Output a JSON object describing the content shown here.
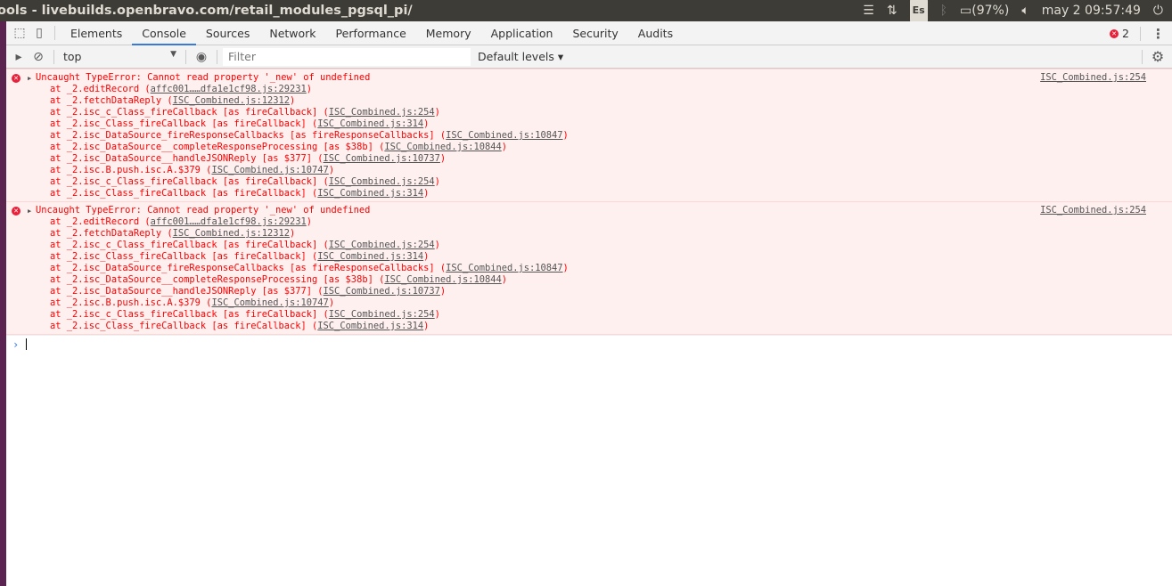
{
  "window": {
    "title": "ools - livebuilds.openbravo.com/retail_modules_pgsql_pi/"
  },
  "tray": {
    "keyboard": "Es",
    "battery": "(97%)",
    "clock": "may  2 09:57:49"
  },
  "tabs": [
    "Elements",
    "Console",
    "Sources",
    "Network",
    "Performance",
    "Memory",
    "Application",
    "Security",
    "Audits"
  ],
  "active_tab": "Console",
  "error_count": "2",
  "toolbar": {
    "context": "top",
    "filter_placeholder": "Filter",
    "levels": "Default levels ▾"
  },
  "messages": [
    {
      "text": "Uncaught TypeError: Cannot read property '_new' of undefined",
      "source": "ISC_Combined.js:254",
      "stack": [
        {
          "text": "at _2.editRecord ",
          "link": "affc001……dfa1e1cf98.js:29231"
        },
        {
          "text": "at _2.fetchDataReply ",
          "link": "ISC_Combined.js:12312"
        },
        {
          "text": "at _2.isc_c_Class_fireCallback [as fireCallback] ",
          "link": "ISC_Combined.js:254"
        },
        {
          "text": "at _2.isc_Class_fireCallback [as fireCallback] ",
          "link": "ISC_Combined.js:314"
        },
        {
          "text": "at _2.isc_DataSource_fireResponseCallbacks [as fireResponseCallbacks] ",
          "link": "ISC_Combined.js:10847"
        },
        {
          "text": "at _2.isc_DataSource__completeResponseProcessing [as $38b] ",
          "link": "ISC_Combined.js:10844"
        },
        {
          "text": "at _2.isc_DataSource__handleJSONReply [as $377] ",
          "link": "ISC_Combined.js:10737"
        },
        {
          "text": "at _2.isc.B.push.isc.A.$379 ",
          "link": "ISC_Combined.js:10747"
        },
        {
          "text": "at _2.isc_c_Class_fireCallback [as fireCallback] ",
          "link": "ISC_Combined.js:254"
        },
        {
          "text": "at _2.isc_Class_fireCallback [as fireCallback] ",
          "link": "ISC_Combined.js:314"
        }
      ]
    },
    {
      "text": "Uncaught TypeError: Cannot read property '_new' of undefined",
      "source": "ISC_Combined.js:254",
      "stack": [
        {
          "text": "at _2.editRecord ",
          "link": "affc001……dfa1e1cf98.js:29231"
        },
        {
          "text": "at _2.fetchDataReply ",
          "link": "ISC_Combined.js:12312"
        },
        {
          "text": "at _2.isc_c_Class_fireCallback [as fireCallback] ",
          "link": "ISC_Combined.js:254"
        },
        {
          "text": "at _2.isc_Class_fireCallback [as fireCallback] ",
          "link": "ISC_Combined.js:314"
        },
        {
          "text": "at _2.isc_DataSource_fireResponseCallbacks [as fireResponseCallbacks] ",
          "link": "ISC_Combined.js:10847"
        },
        {
          "text": "at _2.isc_DataSource__completeResponseProcessing [as $38b] ",
          "link": "ISC_Combined.js:10844"
        },
        {
          "text": "at _2.isc_DataSource__handleJSONReply [as $377] ",
          "link": "ISC_Combined.js:10737"
        },
        {
          "text": "at _2.isc.B.push.isc.A.$379 ",
          "link": "ISC_Combined.js:10747"
        },
        {
          "text": "at _2.isc_c_Class_fireCallback [as fireCallback] ",
          "link": "ISC_Combined.js:254"
        },
        {
          "text": "at _2.isc_Class_fireCallback [as fireCallback] ",
          "link": "ISC_Combined.js:314"
        }
      ]
    }
  ]
}
